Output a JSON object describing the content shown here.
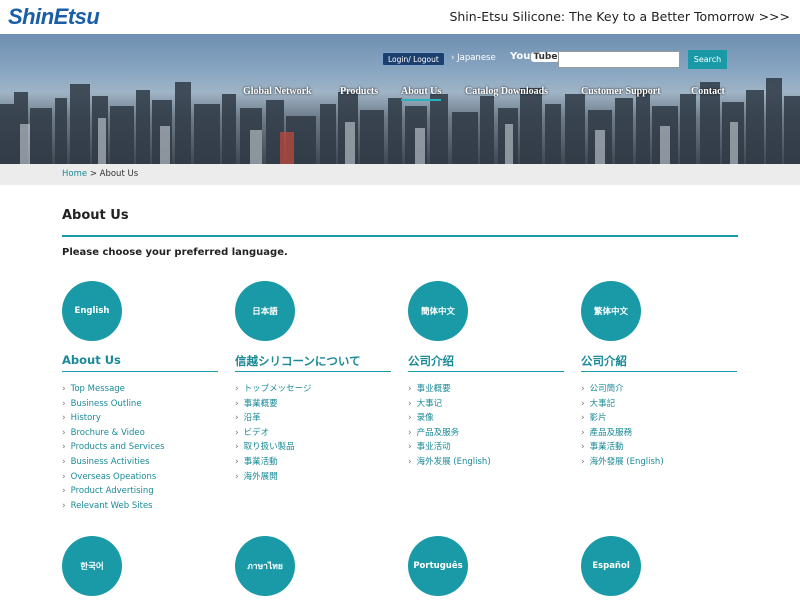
{
  "header": {
    "logo": "ShinEtsu",
    "tagline": "Shin-Etsu Silicone: The Key to a Better Tomorrow >>>"
  },
  "hero": {
    "login_label": "Login/ Logout",
    "lang_link": "Japanese",
    "youtube_label": "You",
    "youtube_tube": "Tube",
    "search_placeholder": "",
    "search_button": "Search",
    "nav": [
      "Global Network",
      "Products",
      "About Us",
      "Catalog Downloads",
      "Customer Support",
      "Contact"
    ],
    "active_nav": "About Us"
  },
  "breadcrumb": {
    "home": "Home",
    "separator": ">",
    "current": "About Us"
  },
  "main": {
    "title": "About Us",
    "prompt": "Please choose your preferred language.",
    "accent_color": "#1a9aa7",
    "languages_row1": [
      {
        "circle": "English",
        "title": "About Us",
        "items": [
          "Top Message",
          "Business Outline",
          "History",
          "Brochure & Video",
          "Products and Services",
          "Business Activities",
          "Overseas Opeations",
          "Product Advertising",
          "Relevant Web Sites"
        ]
      },
      {
        "circle": "日本語",
        "title": "信越シリコーンについて",
        "items": [
          "トップメッセージ",
          "事業概要",
          "沿革",
          "ビデオ",
          "取り扱い製品",
          "事業活動",
          "海外展開"
        ]
      },
      {
        "circle": "簡体中文",
        "title": "公司介绍",
        "items": [
          "事业概要",
          "大事记",
          "录像",
          "产品及服务",
          "事业活动",
          "海外发展 (English)"
        ]
      },
      {
        "circle": "繁体中文",
        "title": "公司介紹",
        "items": [
          "公司簡介",
          "大事記",
          "影片",
          "產品及服務",
          "事業活動",
          "海外發展 (English)"
        ]
      }
    ],
    "languages_row2": [
      "한국어",
      "ภาษาไทย",
      "Português",
      "Español"
    ]
  }
}
